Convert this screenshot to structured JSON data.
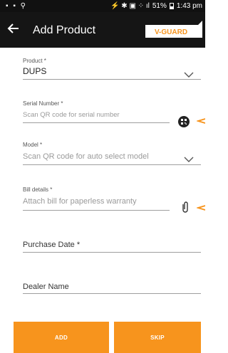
{
  "status_bar": {
    "left_icons": "▪ ▪ ⚲",
    "battery": "51%",
    "time": "1:43 pm",
    "signal": "⚡ ✱ ▣ ⁘ ıl"
  },
  "header": {
    "title": "Add Product",
    "brand": "V-GUARD"
  },
  "form": {
    "product": {
      "label": "Product *",
      "value": "DUPS"
    },
    "serial_number": {
      "label": "Serial Number *",
      "placeholder": "Scan QR code for serial number"
    },
    "model": {
      "label": "Model *",
      "placeholder": "Scan QR code for auto select model"
    },
    "bill_details": {
      "label": "Bill details *",
      "placeholder": "Attach bill for paperless warranty"
    },
    "purchase_date": {
      "label": "Purchase Date *"
    },
    "dealer_name": {
      "label": "Dealer Name"
    }
  },
  "buttons": {
    "add_label": "ADD",
    "skip_label": "SKIP"
  },
  "colors": {
    "accent": "#f7941d",
    "app_bar": "#151515",
    "status_bar": "#111111"
  },
  "icons": [
    "back-arrow-icon",
    "chevron-down-icon",
    "qr-code-icon",
    "paperclip-icon",
    "pointer-arrow-icon"
  ]
}
